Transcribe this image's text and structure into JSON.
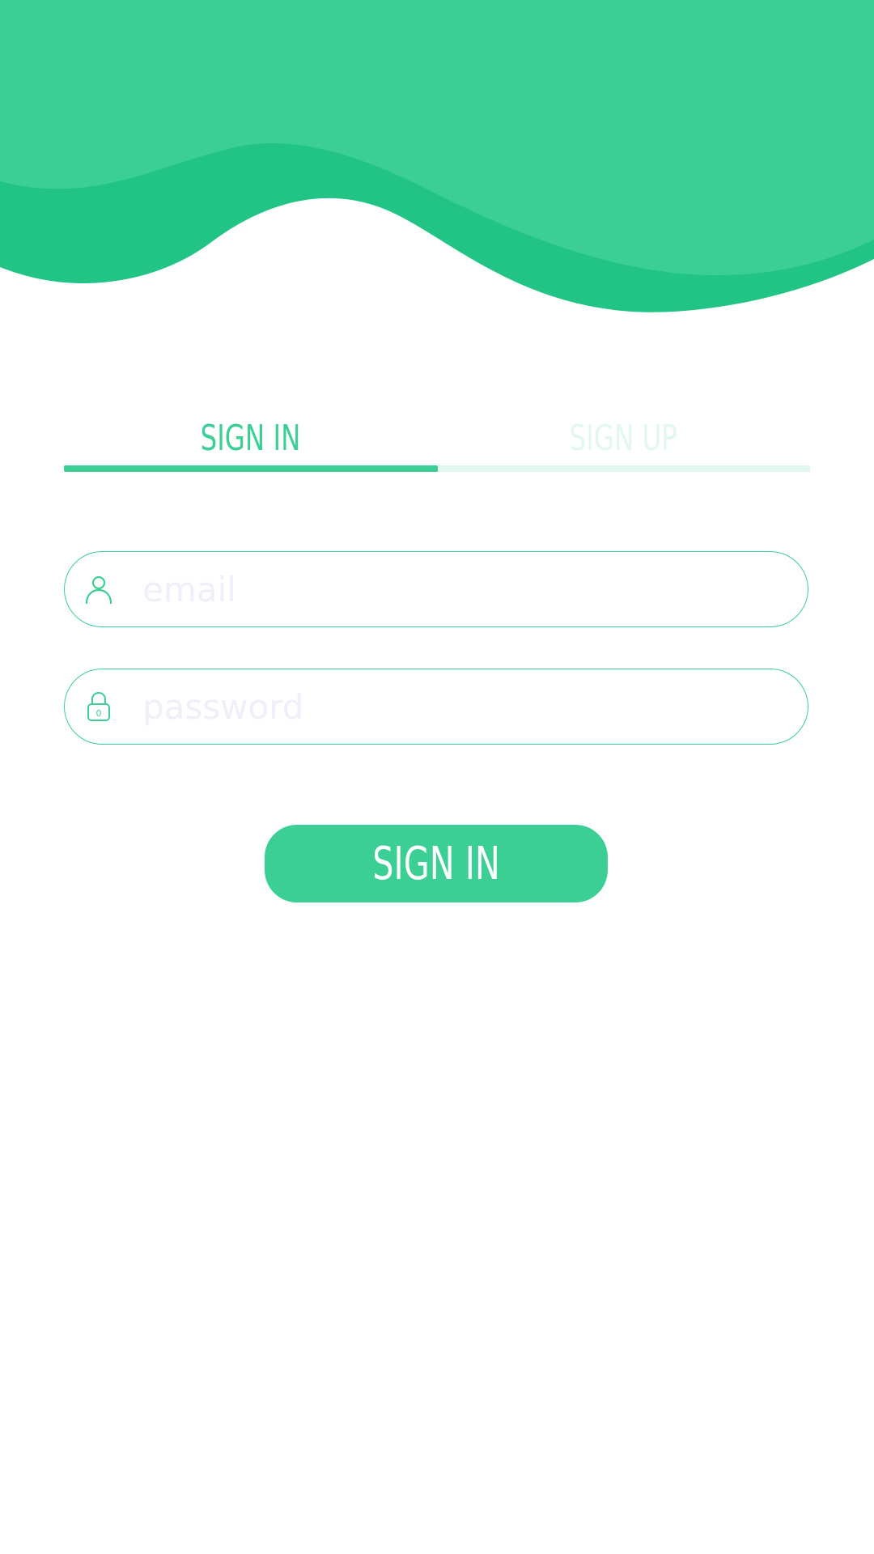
{
  "colors": {
    "accent": "#3ccf95",
    "accent_dark": "#22c486",
    "accent_light": "#e1f7ef",
    "placeholder": "#eeeff9",
    "background": "#ffffff"
  },
  "tabs": [
    {
      "label": "SIGN IN",
      "active": true
    },
    {
      "label": "SIGN UP",
      "active": false
    }
  ],
  "form": {
    "email": {
      "placeholder": "email",
      "value": "",
      "icon": "user-icon"
    },
    "password": {
      "placeholder": "password",
      "value": "",
      "icon": "lock-icon",
      "icon_glyph": "0"
    },
    "submit_label": "SIGN IN"
  }
}
